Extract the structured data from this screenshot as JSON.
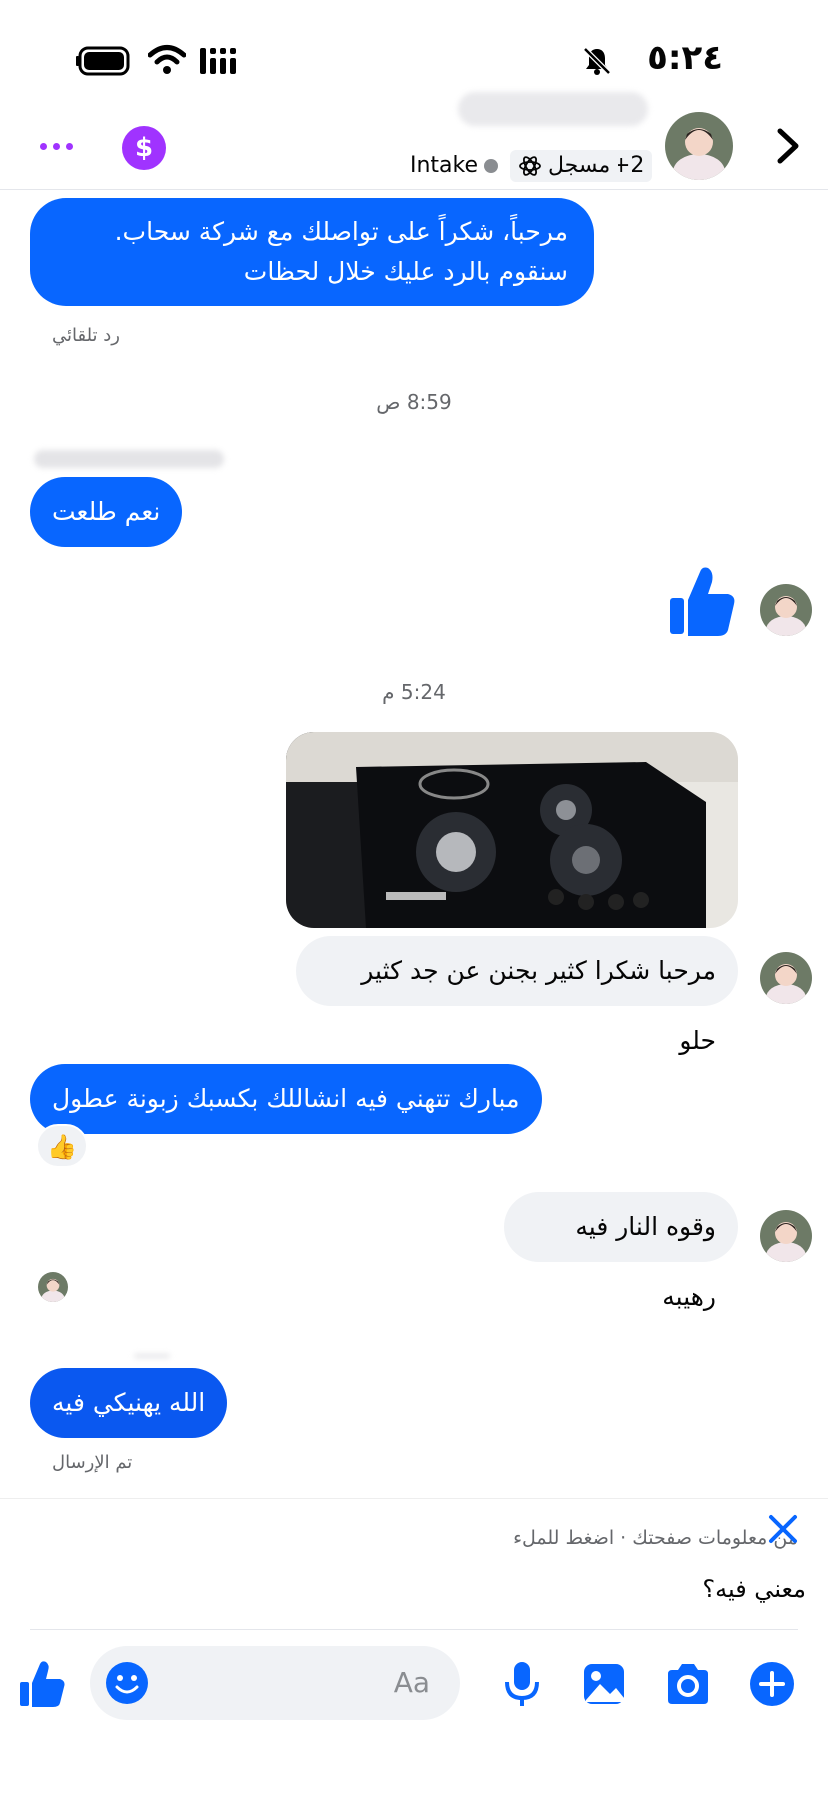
{
  "status_bar": {
    "time": "٥:٢٤"
  },
  "header": {
    "tags": {
      "plus": "+2",
      "registered": "مسجل",
      "intake": "Intake"
    },
    "dollar_symbol": "$"
  },
  "messages": {
    "auto_reply": "مرحباً، شكراً على تواصلك مع شركة سحاب. سنقوم بالرد عليك خلال لحظات",
    "auto_reply_label": "رد تلقائي",
    "time_1": "8:59 ص",
    "msg_yes": "نعم طلعت",
    "time_2": "5:24 م",
    "msg_thanks": "مرحبا شكرا كثير بجنن عن جد كثير حلو",
    "msg_congrats": "مبارك تتهني فيه انشاللك  بكسبك زبونة عطول",
    "reaction_emoji": "👍",
    "msg_fire": "وقوه النار فيه رهيبه",
    "msg_bless": "الله يهنيكي فيه",
    "sent_label": "تم الإرسال"
  },
  "compose": {
    "hint": "من معلومات صفحتك · اضغط للملء",
    "draft": "معني فيه؟",
    "placeholder": "Aa"
  },
  "colors": {
    "messenger_blue": "#0866ff",
    "incoming_grey": "#f0f2f5",
    "purple": "#a033ff"
  }
}
